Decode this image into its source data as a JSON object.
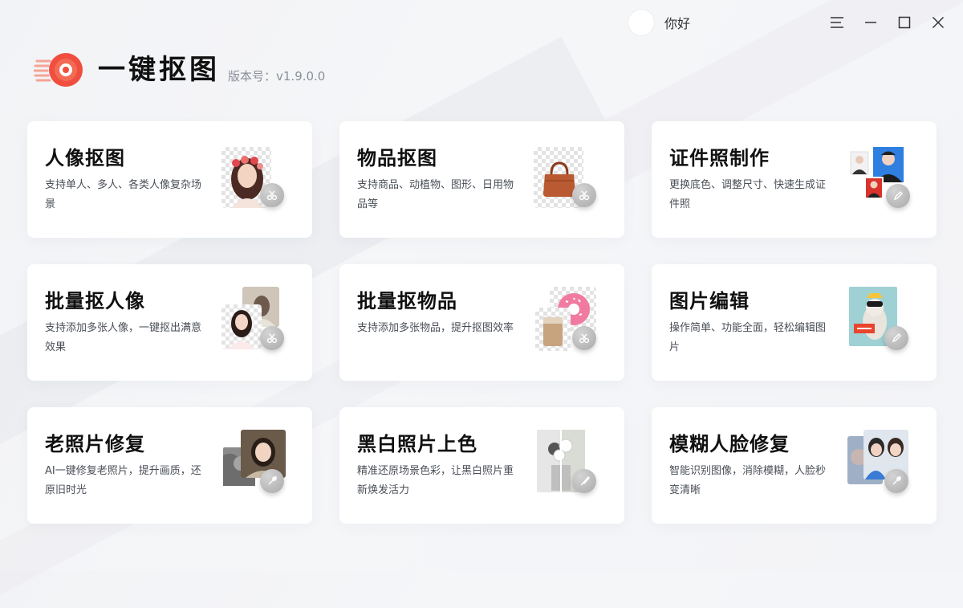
{
  "window": {
    "user_name": "你好"
  },
  "brand": {
    "app_title": "一键抠图",
    "version": "版本号：v1.9.0.0"
  },
  "cards": [
    {
      "title": "人像抠图",
      "desc": "支持单人、多人、各类人像复杂场景",
      "icon": "scissors-icon"
    },
    {
      "title": "物品抠图",
      "desc": "支持商品、动植物、图形、日用物品等",
      "icon": "scissors-icon"
    },
    {
      "title": "证件照制作",
      "desc": "更换底色、调整尺寸、快速生成证件照",
      "icon": "pencil-icon"
    },
    {
      "title": "批量抠人像",
      "desc": "支持添加多张人像，一键抠出满意效果",
      "icon": "scissors-icon"
    },
    {
      "title": "批量抠物品",
      "desc": "支持添加多张物品，提升抠图效率",
      "icon": "scissors-icon"
    },
    {
      "title": "图片编辑",
      "desc": "操作简单、功能全面，轻松编辑图片",
      "icon": "pencil-icon"
    },
    {
      "title": "老照片修复",
      "desc": "AI一键修复老照片，提升画质，还原旧时光",
      "icon": "wrench-icon"
    },
    {
      "title": "黑白照片上色",
      "desc": "精准还原场景色彩，让黑白照片重新焕发活力",
      "icon": "brush-icon"
    },
    {
      "title": "模糊人脸修复",
      "desc": "智能识别图像，消除模糊，人脸秒变清晰",
      "icon": "wrench-icon"
    }
  ],
  "colors": {
    "accent": "#f04e3e",
    "card_bg": "#ffffff",
    "page_bg": "#f3f4f7"
  }
}
